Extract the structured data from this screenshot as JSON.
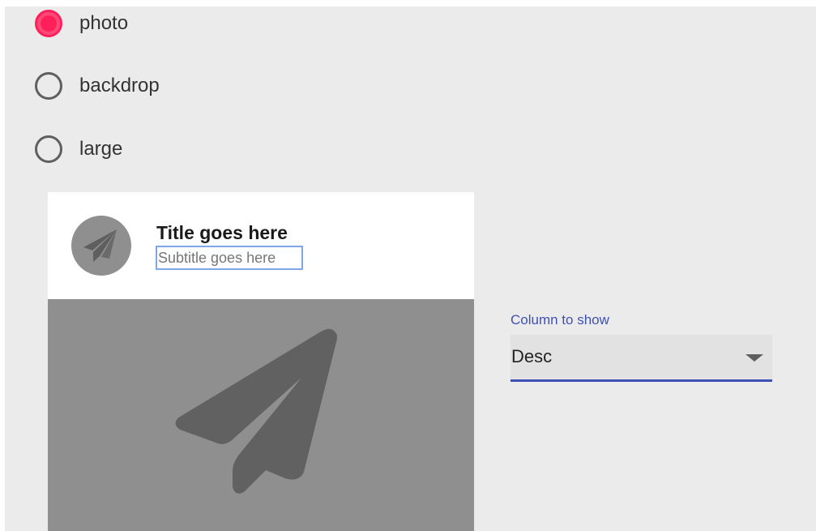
{
  "radio_group": {
    "options": [
      {
        "label": "photo",
        "checked": true
      },
      {
        "label": "backdrop",
        "checked": false
      },
      {
        "label": "large",
        "checked": false
      }
    ]
  },
  "card": {
    "title": "Title goes here",
    "subtitle": "Subtitle goes here",
    "avatar_icon": "send-icon",
    "media_icon": "send-icon"
  },
  "column_select": {
    "label": "Column to show",
    "selected": "Desc"
  },
  "colors": {
    "accent": "#ff1f5a",
    "primary": "#3f51b5",
    "background": "#ebebeb"
  }
}
